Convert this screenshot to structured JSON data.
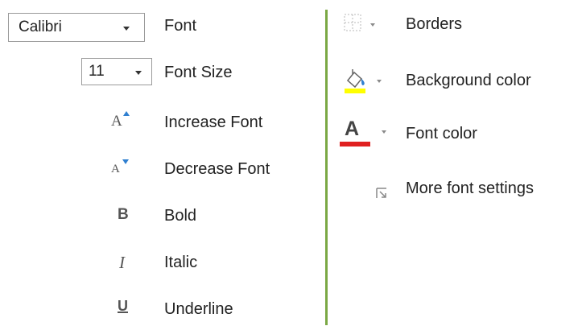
{
  "font": {
    "value": "Calibri",
    "label": "Font"
  },
  "font_size": {
    "value": "11",
    "label": "Font Size"
  },
  "commands": {
    "increase_font": "Increase Font",
    "decrease_font": "Decrease Font",
    "bold": "Bold",
    "italic": "Italic",
    "underline": "Underline",
    "borders": "Borders",
    "background_color": "Background color",
    "font_color": "Font color",
    "more_font_settings": "More font settings"
  },
  "glyphs": {
    "increase_font": "A",
    "decrease_font": "A",
    "bold": "B",
    "italic": "I",
    "underline": "U",
    "font_color": "A"
  },
  "colors": {
    "divider": "#7aa844",
    "background_highlight": "#ffff00",
    "font_color_bar": "#e02020",
    "size_arrow": "#2f7fd0"
  }
}
